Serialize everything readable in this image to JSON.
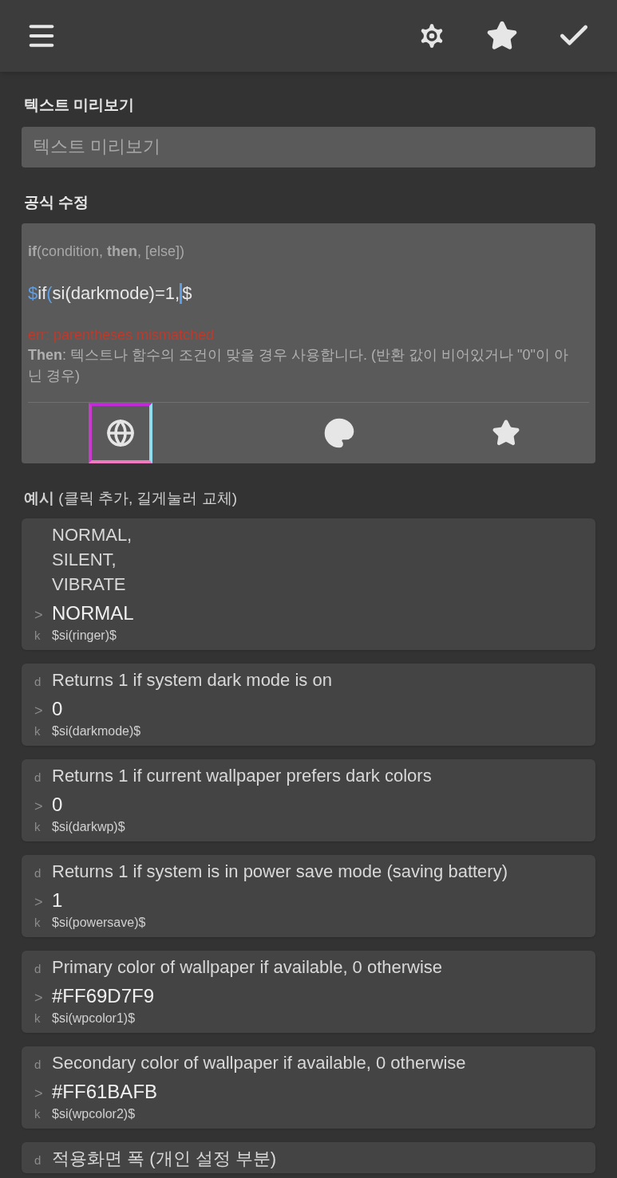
{
  "preview": {
    "label": "텍스트 미리보기",
    "placeholder": "텍스트 미리보기"
  },
  "formula": {
    "label": "공식 수정",
    "signature": "**if**(condition, **then**, [else])",
    "expression": [
      {
        "text": "$",
        "color": "#5b9ee6"
      },
      {
        "text": "if",
        "color": "#e8e8e8"
      },
      {
        "text": "(",
        "color": "#5b9ee6"
      },
      {
        "text": "si(darkmode)=1,",
        "color": "#e8e8e8"
      },
      {
        "text": "$",
        "color": "#e8e8e8"
      }
    ],
    "error": "err: parentheses mismatched",
    "help": "**Then**: 텍스트나 함수의 조건이 맞을 경우 사용합니다. (반환 값이 비어있거나 \"0\"이 아닌 경우)",
    "tools": [
      {
        "kind": "globe",
        "selected": true
      },
      {
        "kind": "palette",
        "selected": false
      },
      {
        "kind": "star",
        "selected": false
      }
    ]
  },
  "examples": {
    "label": "**예시** (클릭 추가, 길게눌러 교체)",
    "items": [
      {
        "description": [
          "NORMAL,",
          "SILENT,",
          "VIBRATE"
        ],
        "value_marker": ">",
        "value": "NORMAL",
        "key_marker": "k",
        "key": "$si(ringer)$"
      },
      {
        "description_marker": "d",
        "description": [
          "Returns 1 if system dark mode is on"
        ],
        "value_marker": ">",
        "value": "0",
        "key_marker": "k",
        "key": "$si(darkmode)$"
      },
      {
        "description_marker": "d",
        "description": [
          "Returns 1 if current wallpaper prefers dark colors"
        ],
        "value_marker": ">",
        "value": "0",
        "key_marker": "k",
        "key": "$si(darkwp)$"
      },
      {
        "description_marker": "d",
        "description": [
          "Returns 1 if system is in power save mode (saving battery)"
        ],
        "value_marker": ">",
        "value": "1",
        "key_marker": "k",
        "key": "$si(powersave)$"
      },
      {
        "description_marker": "d",
        "description": [
          "Primary color of wallpaper if available, 0 otherwise"
        ],
        "value_marker": ">",
        "value": "#FF69D7F9",
        "key_marker": "k",
        "key": "$si(wpcolor1)$"
      },
      {
        "description_marker": "d",
        "description": [
          "Secondary color of wallpaper if available, 0 otherwise"
        ],
        "value_marker": ">",
        "value": "#FF61BAFB",
        "key_marker": "k",
        "key": "$si(wpcolor2)$"
      },
      {
        "description_marker": "d",
        "description": [
          "적용화면 폭 (개인 설정 부분)"
        ]
      }
    ]
  }
}
